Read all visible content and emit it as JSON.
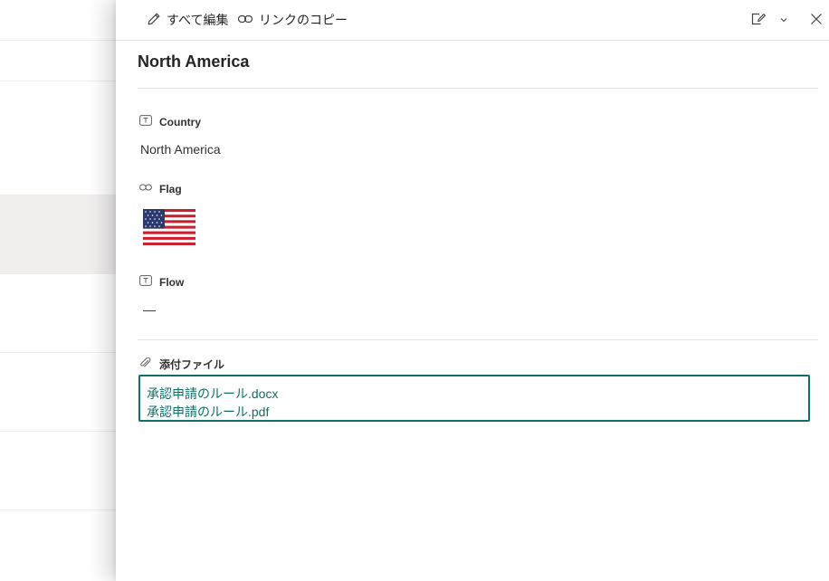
{
  "commandbar": {
    "edit_all_label": "すべて編集",
    "copy_link_label": "リンクのコピー"
  },
  "item": {
    "title": "North America"
  },
  "fields": {
    "country": {
      "label": "Country",
      "value": "North America",
      "icon": "text-field-icon"
    },
    "flag": {
      "label": "Flag",
      "icon": "link-icon",
      "image": "us-flag-image"
    },
    "flow": {
      "label": "Flow",
      "value": "—",
      "icon": "text-field-icon"
    },
    "attachments": {
      "label": "添付ファイル",
      "icon": "paperclip-icon",
      "files": [
        "承認申請のルール.docx",
        "承認申請のルール.pdf"
      ]
    }
  },
  "colors": {
    "accent": "#0f6f66",
    "selected_row": "#f0efee"
  }
}
